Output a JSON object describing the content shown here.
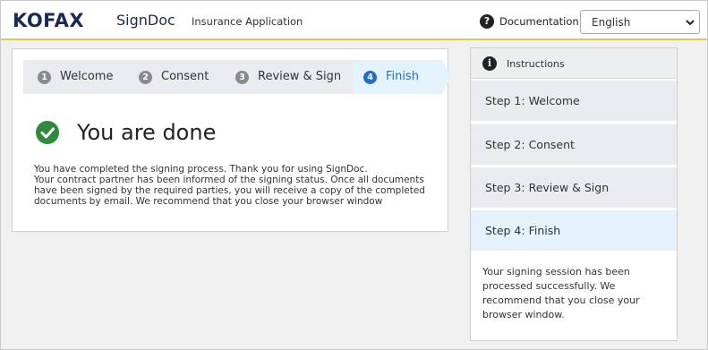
{
  "header": {
    "logo": "KOFAX",
    "product": "SignDoc",
    "app_name": "Insurance Application",
    "help_icon": "?",
    "documentation_label": "Documentation",
    "language": {
      "selected": "English"
    }
  },
  "stepper": {
    "steps": [
      {
        "number": "1",
        "label": "Welcome",
        "active": false
      },
      {
        "number": "2",
        "label": "Consent",
        "active": false
      },
      {
        "number": "3",
        "label": "Review & Sign",
        "active": false
      },
      {
        "number": "4",
        "label": "Finish",
        "active": true
      }
    ]
  },
  "main": {
    "title": "You are done",
    "messages": [
      "You have completed the signing process. Thank you for using SignDoc.",
      "Your contract partner has been informed of the signing status. Once all documents have been signed by the required parties, you will receive a copy of the completed documents by email. We recommend that you close your browser window"
    ]
  },
  "instructions": {
    "title": "Instructions",
    "info_icon": "i",
    "steps": [
      {
        "label": "Step 1: Welcome"
      },
      {
        "label": "Step 2: Consent"
      },
      {
        "label": "Step 3: Review & Sign"
      },
      {
        "label": "Step 4: Finish",
        "active": true
      }
    ],
    "text": "Your signing session has been processed successfully. We recommend that you close your browser window."
  },
  "colors": {
    "brand_navy": "#1a2a57",
    "accent_blue": "#1f6fc7",
    "success_green": "#2f8a3e",
    "header_rule": "#e5c84a"
  },
  "icons": {
    "help": "question-circle-icon",
    "info": "info-circle-icon",
    "success": "check-circle-icon",
    "dropdown": "chevron-down-icon"
  }
}
